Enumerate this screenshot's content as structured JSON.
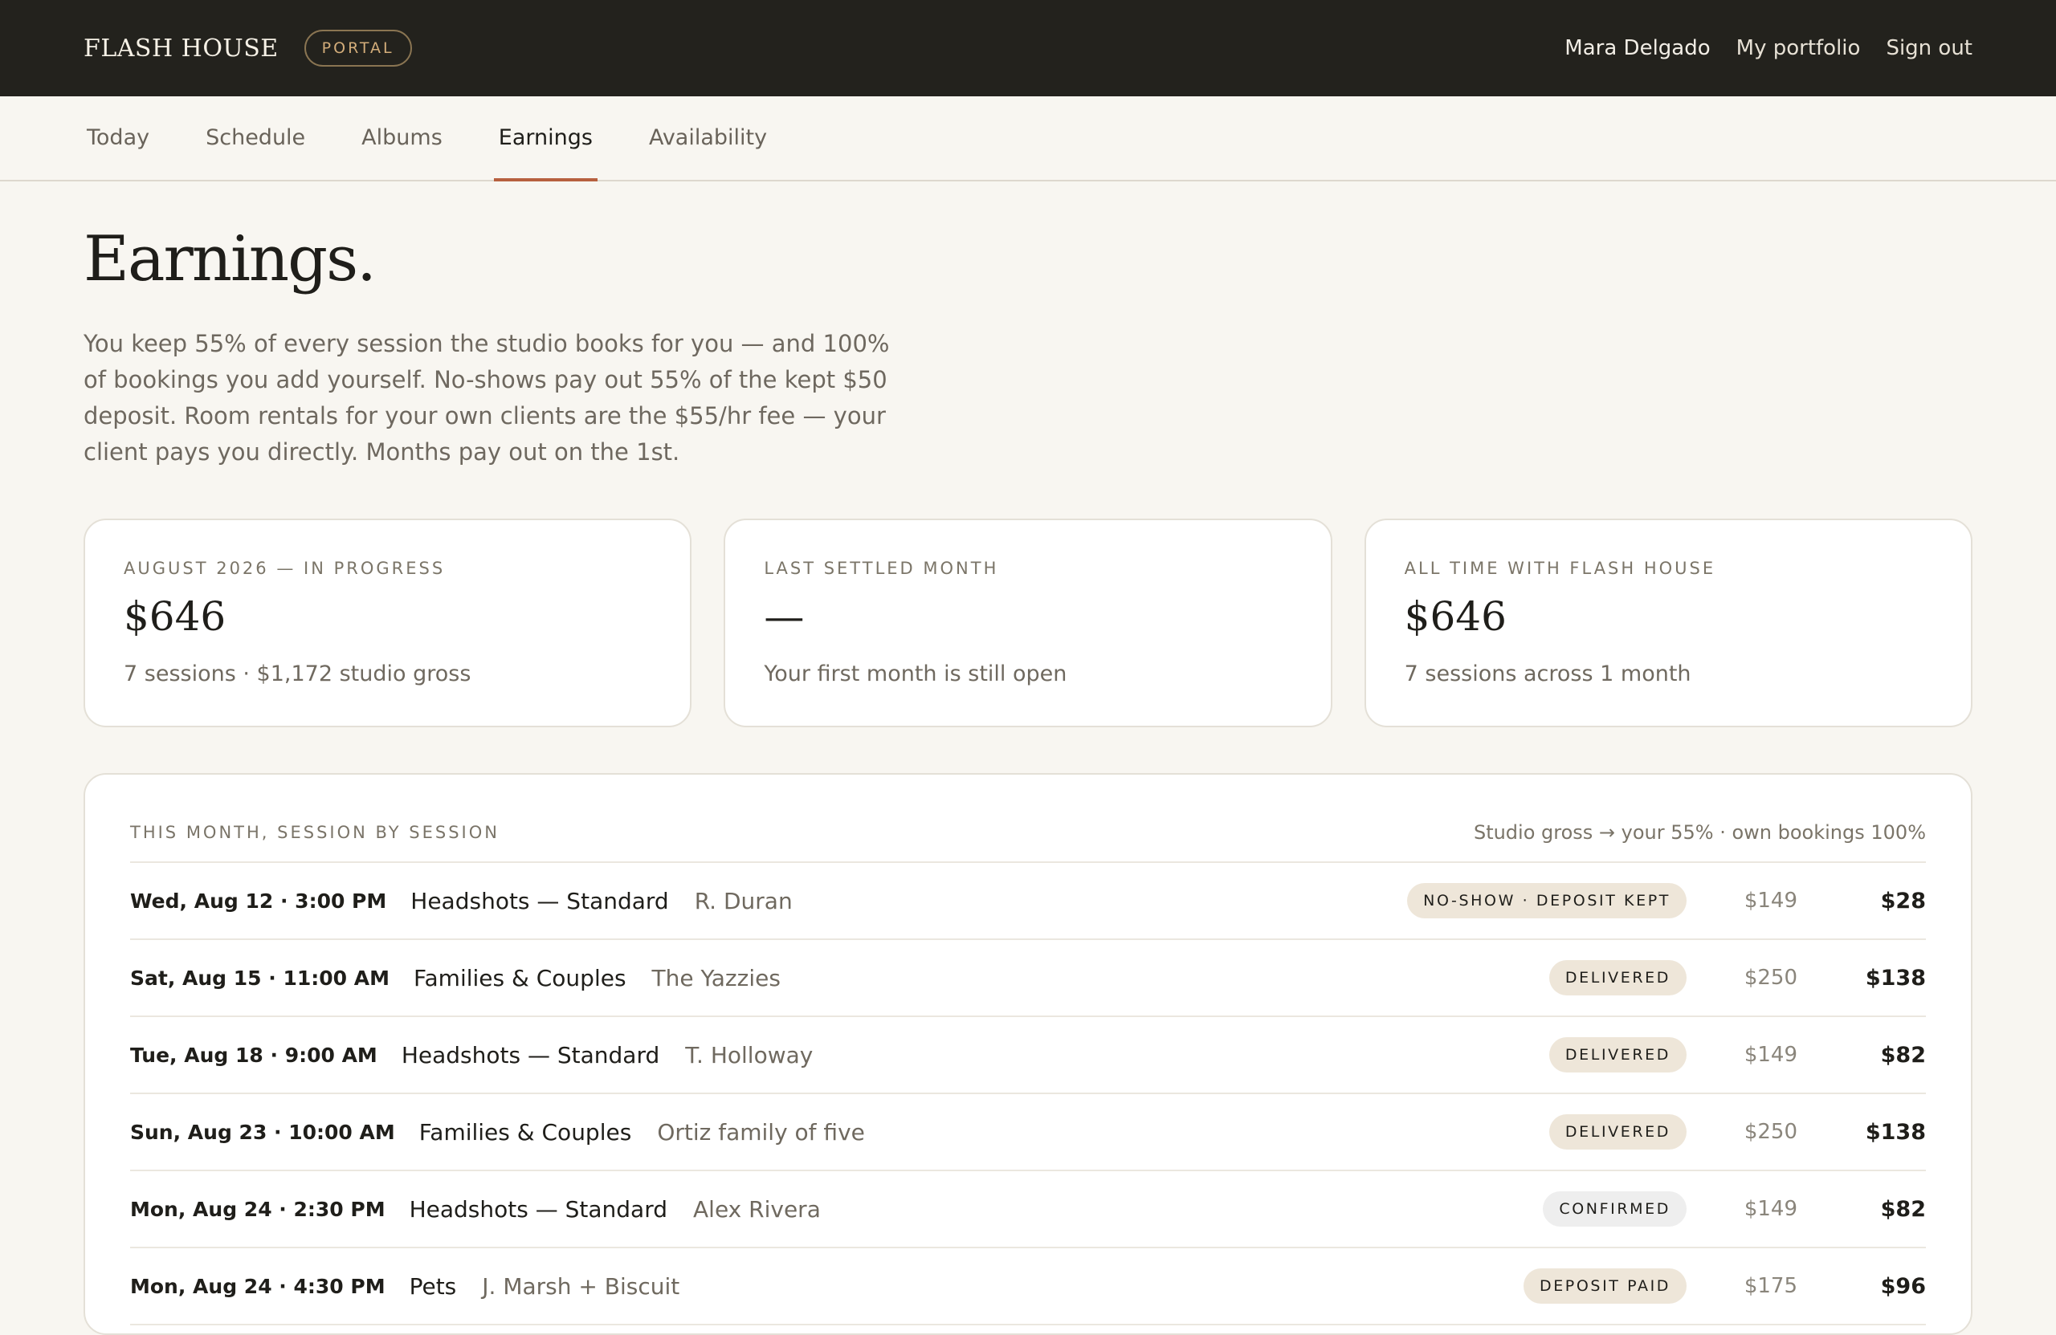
{
  "header": {
    "brand": "FLASH HOUSE",
    "portal_pill": "PORTAL",
    "user_name": "Mara Delgado",
    "links": [
      "My portfolio",
      "Sign out"
    ]
  },
  "tabs": [
    {
      "label": "Today",
      "active": false
    },
    {
      "label": "Schedule",
      "active": false
    },
    {
      "label": "Albums",
      "active": false
    },
    {
      "label": "Earnings",
      "active": true
    },
    {
      "label": "Availability",
      "active": false
    }
  ],
  "page": {
    "title": "Earnings.",
    "intro": "You keep 55% of every session the studio books for you — and 100% of bookings you add yourself. No-shows pay out 55% of the kept $50 deposit. Room rentals for your own clients are the $55/hr fee — your client pays you directly. Months pay out on the 1st."
  },
  "cards": [
    {
      "label": "AUGUST 2026 — IN PROGRESS",
      "value": "$646",
      "note": "7 sessions · $1,172 studio gross"
    },
    {
      "label": "LAST SETTLED MONTH",
      "value": "—",
      "note": "Your first month is still open"
    },
    {
      "label": "ALL TIME WITH FLASH HOUSE",
      "value": "$646",
      "note": "7 sessions across 1 month"
    }
  ],
  "sessions": {
    "title": "THIS MONTH, SESSION BY SESSION",
    "note": "Studio gross → your 55% · own bookings 100%",
    "rows": [
      {
        "when": "Wed, Aug 12 · 3:00 PM",
        "service": "Headshots — Standard",
        "client": "R. Duran",
        "status": "NO-SHOW · DEPOSIT KEPT",
        "gross": "$149",
        "payout": "$28"
      },
      {
        "when": "Sat, Aug 15 · 11:00 AM",
        "service": "Families & Couples",
        "client": "The Yazzies",
        "status": "DELIVERED",
        "gross": "$250",
        "payout": "$138"
      },
      {
        "when": "Tue, Aug 18 · 9:00 AM",
        "service": "Headshots — Standard",
        "client": "T. Holloway",
        "status": "DELIVERED",
        "gross": "$149",
        "payout": "$82"
      },
      {
        "when": "Sun, Aug 23 · 10:00 AM",
        "service": "Families & Couples",
        "client": "Ortiz family of five",
        "status": "DELIVERED",
        "gross": "$250",
        "payout": "$138"
      },
      {
        "when": "Mon, Aug 24 · 2:30 PM",
        "service": "Headshots — Standard",
        "client": "Alex Rivera",
        "status": "CONFIRMED",
        "gross": "$149",
        "payout": "$82"
      },
      {
        "when": "Mon, Aug 24 · 4:30 PM",
        "service": "Pets",
        "client": "J. Marsh + Biscuit",
        "status": "DEPOSIT PAID",
        "gross": "$175",
        "payout": "$96"
      }
    ]
  },
  "colors": {
    "topbar_background": "#23221d",
    "page_background": "#f8f6f1",
    "accent": "#b7603f",
    "badge_warm": "#eee6d9",
    "badge_neutral": "#eeeeee"
  }
}
